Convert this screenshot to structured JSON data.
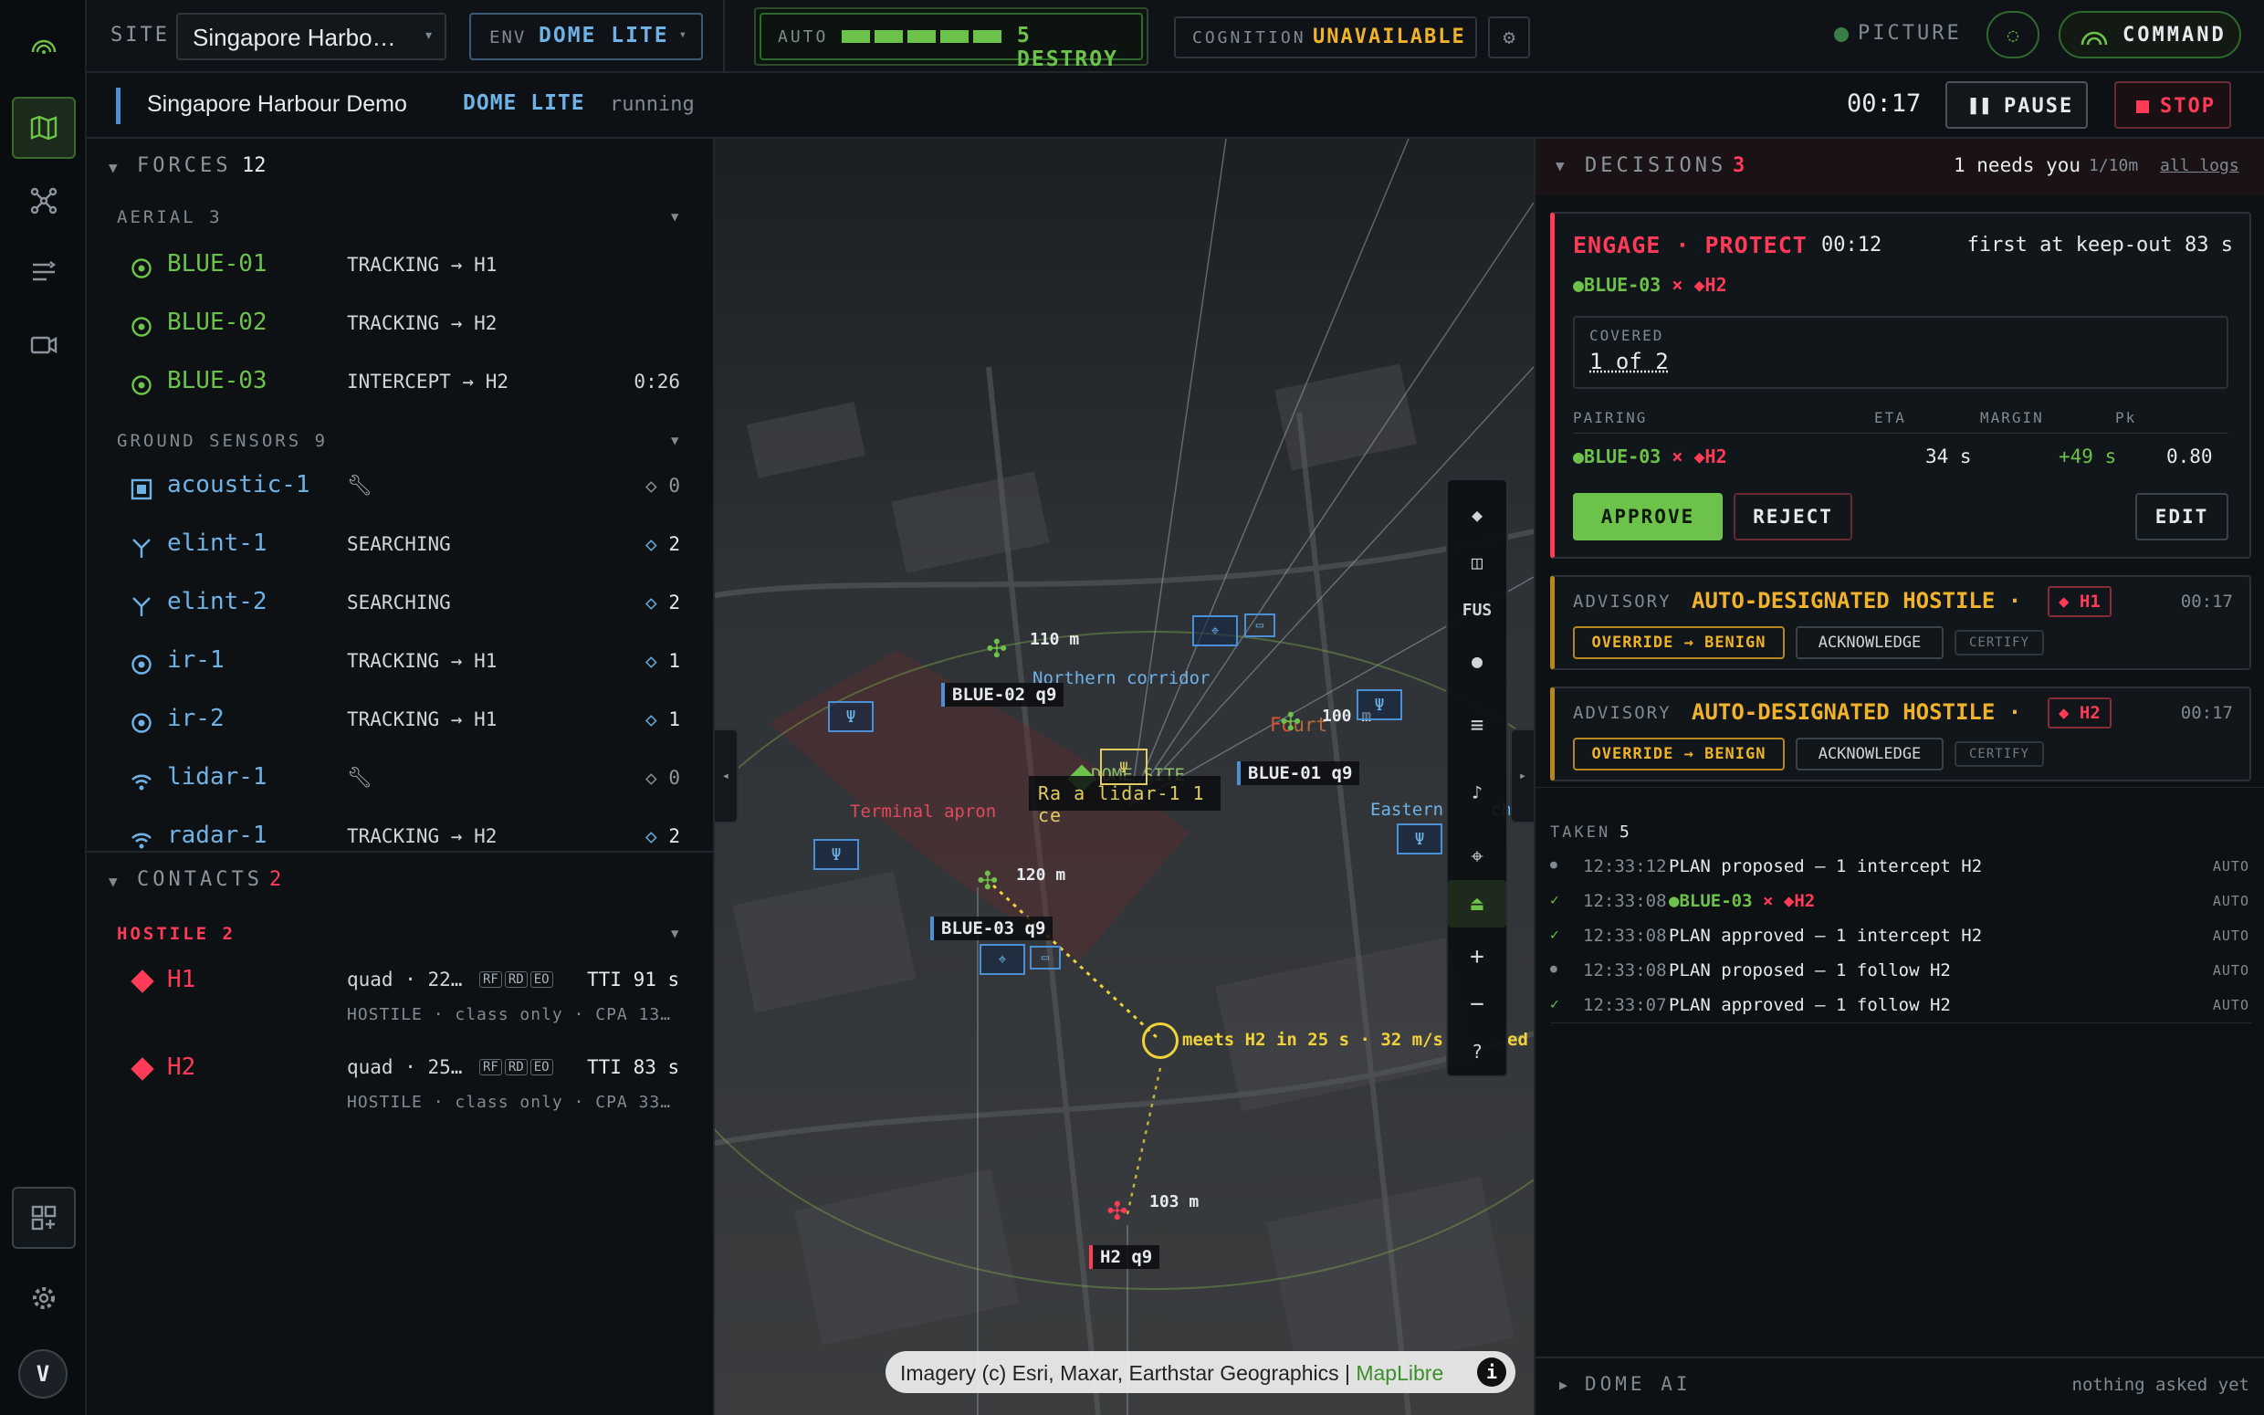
{
  "topbar": {
    "site_label": "SITE",
    "site_value": "Singapore Harbo…",
    "env_label": "ENV",
    "env_value": "DOME LITE",
    "auto_label": "AUTO",
    "auto_level_text": "5 DESTROY",
    "auto_level": 5,
    "cognition_label": "COGNITION",
    "cognition_value": "UNAVAILABLE",
    "picture_label": "PICTURE",
    "command_label": "COMMAND"
  },
  "subbar": {
    "title": "Singapore Harbour Demo",
    "env": "DOME LITE",
    "status": "running",
    "timer": "00:17",
    "pause_label": "PAUSE",
    "stop_label": "STOP"
  },
  "rail": {
    "avatar_letter": "V"
  },
  "forces": {
    "header": "FORCES",
    "count": "12",
    "aerial_header": "AERIAL 3",
    "aerial": [
      {
        "name": "BLUE-01",
        "status": "TRACKING → H1",
        "extra": ""
      },
      {
        "name": "BLUE-02",
        "status": "TRACKING → H2",
        "extra": ""
      },
      {
        "name": "BLUE-03",
        "status": "INTERCEPT → H2",
        "extra": "0:26"
      }
    ],
    "ground_header": "GROUND SENSORS 9",
    "ground": [
      {
        "name": "acoustic-1",
        "status": "",
        "count": "0",
        "icon": "square-sensor-icon",
        "wrench": true
      },
      {
        "name": "elint-1",
        "status": "SEARCHING",
        "count": "2",
        "icon": "antenna-icon",
        "wrench": false
      },
      {
        "name": "elint-2",
        "status": "SEARCHING",
        "count": "2",
        "icon": "antenna-icon",
        "wrench": false
      },
      {
        "name": "ir-1",
        "status": "TRACKING → H1",
        "count": "1",
        "icon": "target-icon",
        "wrench": false
      },
      {
        "name": "ir-2",
        "status": "TRACKING → H1",
        "count": "1",
        "icon": "target-icon",
        "wrench": false
      },
      {
        "name": "lidar-1",
        "status": "",
        "count": "0",
        "icon": "wifi-icon",
        "wrench": true
      },
      {
        "name": "radar-1",
        "status": "TRACKING → H2",
        "count": "2",
        "icon": "wifi-icon",
        "wrench": false
      }
    ]
  },
  "contacts": {
    "header": "CONTACTS",
    "count": "2",
    "hostile_header": "HOSTILE 2",
    "items": [
      {
        "name": "H1",
        "desc": "quad · 22…",
        "tags": [
          "RF",
          "RD",
          "EO"
        ],
        "tti": "TTI 91 s",
        "sub": "HOSTILE · class only · CPA 13…"
      },
      {
        "name": "H2",
        "desc": "quad · 25…",
        "tags": [
          "RF",
          "RD",
          "EO"
        ],
        "tti": "TTI 83 s",
        "sub": "HOSTILE · class only · CPA 33…"
      }
    ]
  },
  "map": {
    "labels": {
      "blue02": "BLUE-02 q9",
      "blue01": "BLUE-01 q9",
      "blue03": "BLUE-03 q9",
      "h2": "H2 q9",
      "alt_blue02": "110 m",
      "alt_blue01": "100 m",
      "alt_blue03": "120 m",
      "alt_h2": "103 m",
      "northern": "Northern corridor",
      "terminal": "Terminal apron",
      "eastern": "Eastern",
      "eastern_tail": "ch",
      "forecourt": "Fo",
      "forecourt_tail": "urt",
      "dome_site": "DOME SITE",
      "lidar_overlay": "Ra a lidar-1 1 ce",
      "meets": "meets H2 in 25 s · 32 m/s",
      "meets_tail": "ed",
      "attribution": "Imagery (c) Esri, Maxar, Earthstar Geographics | ",
      "maplibre": "MapLibre",
      "fus": "FUS",
      "help": "?"
    }
  },
  "decisions": {
    "header": "DECISIONS",
    "count": "3",
    "needs": "1 needs you",
    "rate": "1/10m",
    "all_logs": "all logs",
    "engage": {
      "title": "ENGAGE · PROTECT",
      "time": "00:12",
      "first": "first at keep-out 83 s",
      "pair_blue": "BLUE-03",
      "pair_x": "×",
      "pair_h": "H2",
      "covered_label": "COVERED",
      "covered_value": "1 of 2",
      "cols": {
        "pairing": "PAIRING",
        "eta": "ETA",
        "margin": "MARGIN",
        "pk": "Pk"
      },
      "row": {
        "blue": "BLUE-03",
        "h": "H2",
        "eta": "34 s",
        "margin": "+49 s",
        "pk": "0.80"
      },
      "approve": "APPROVE",
      "reject": "REJECT",
      "edit": "EDIT"
    },
    "advisories": [
      {
        "kind": "ADVISORY",
        "title": "AUTO-DESIGNATED HOSTILE ·",
        "target": "H1",
        "time": "00:17",
        "override": "OVERRIDE → BENIGN",
        "ack": "ACKNOWLEDGE",
        "certify": "CERTIFY"
      },
      {
        "kind": "ADVISORY",
        "title": "AUTO-DESIGNATED HOSTILE ·",
        "target": "H2",
        "time": "00:17",
        "override": "OVERRIDE → BENIGN",
        "ack": "ACKNOWLEDGE",
        "certify": "CERTIFY"
      }
    ],
    "taken_label": "TAKEN",
    "taken_count": "5",
    "taken": [
      {
        "mark": "●",
        "time": "12:33:12",
        "text": "PLAN proposed — 1 intercept H2",
        "mode": "AUTO",
        "pair": false
      },
      {
        "mark": "✓",
        "time": "12:33:08",
        "text": "",
        "mode": "AUTO",
        "pair": true,
        "blue": "BLUE-03",
        "h": "H2"
      },
      {
        "mark": "✓",
        "time": "12:33:08",
        "text": "PLAN approved — 1 intercept H2",
        "mode": "AUTO",
        "pair": false
      },
      {
        "mark": "●",
        "time": "12:33:08",
        "text": "PLAN proposed — 1 follow H2",
        "mode": "AUTO",
        "pair": false
      },
      {
        "mark": "✓",
        "time": "12:33:07",
        "text": "PLAN approved — 1 follow H2",
        "mode": "AUTO",
        "pair": false
      }
    ],
    "dome_ai": "DOME AI",
    "dome_ai_status": "nothing asked yet"
  },
  "colors": {
    "accent_green": "#6cc24a",
    "hostile_red": "#ff3b57",
    "amber": "#f0b22b",
    "blue": "#6fb3e6"
  }
}
